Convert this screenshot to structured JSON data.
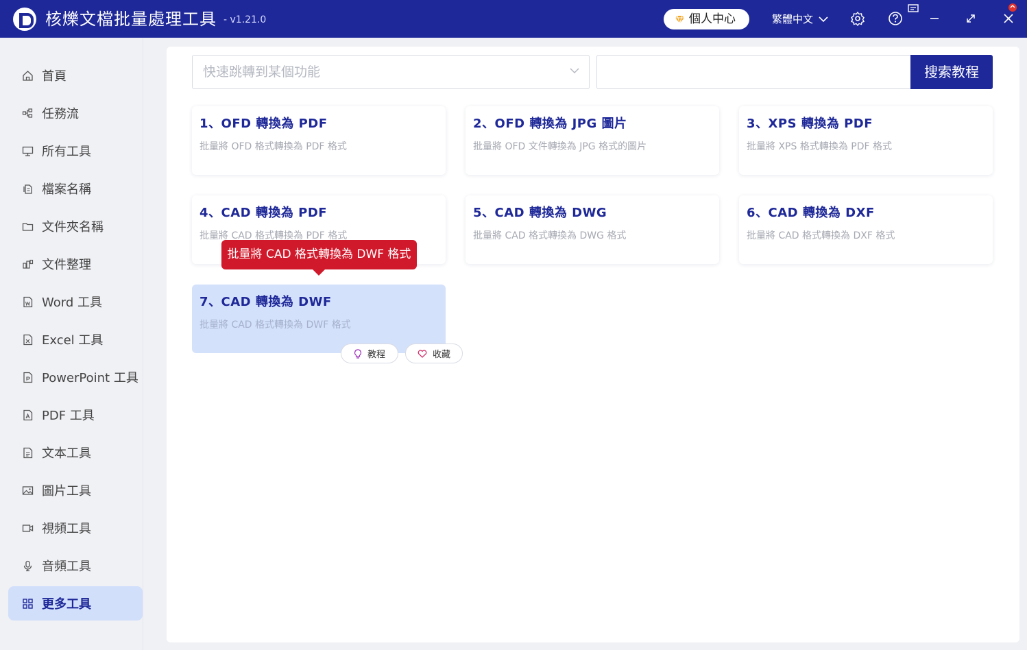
{
  "app": {
    "title": "核爍文檔批量處理工具",
    "version": "- v1.21.0"
  },
  "header": {
    "user_center": "個人中心",
    "language": "繁體中文"
  },
  "sidebar": {
    "items": [
      {
        "label": "首頁",
        "icon": "home-icon"
      },
      {
        "label": "任務流",
        "icon": "workflow-icon"
      },
      {
        "label": "所有工具",
        "icon": "monitor-icon"
      },
      {
        "label": "檔案名稱",
        "icon": "file-copy-icon"
      },
      {
        "label": "文件夾名稱",
        "icon": "folder-icon"
      },
      {
        "label": "文件整理",
        "icon": "organize-icon"
      },
      {
        "label": "Word 工具",
        "icon": "word-file-icon"
      },
      {
        "label": "Excel 工具",
        "icon": "excel-file-icon"
      },
      {
        "label": "PowerPoint 工具",
        "icon": "ppt-file-icon"
      },
      {
        "label": "PDF 工具",
        "icon": "pdf-file-icon"
      },
      {
        "label": "文本工具",
        "icon": "text-file-icon"
      },
      {
        "label": "圖片工具",
        "icon": "image-icon"
      },
      {
        "label": "視頻工具",
        "icon": "video-icon"
      },
      {
        "label": "音頻工具",
        "icon": "microphone-icon"
      },
      {
        "label": "更多工具",
        "icon": "grid-icon",
        "active": true
      }
    ]
  },
  "search": {
    "select_placeholder": "快速跳轉到某個功能",
    "input_value": "",
    "button_label": "搜索教程"
  },
  "cards": [
    {
      "title": "1、OFD 轉換為 PDF",
      "desc": "批量將 OFD 格式轉換為 PDF 格式"
    },
    {
      "title": "2、OFD 轉換為 JPG 圖片",
      "desc": "批量將 OFD 文件轉換為 JPG 格式的圖片"
    },
    {
      "title": "3、XPS 轉換為 PDF",
      "desc": "批量將 XPS 格式轉換為 PDF 格式"
    },
    {
      "title": "4、CAD 轉換為 PDF",
      "desc": "批量將 CAD 格式轉換為 PDF 格式"
    },
    {
      "title": "5、CAD 轉換為 DWG",
      "desc": "批量將 CAD 格式轉換為 DWG 格式"
    },
    {
      "title": "6、CAD 轉換為 DXF",
      "desc": "批量將 CAD 格式轉換為 DXF 格式"
    },
    {
      "title": "7、CAD 轉換為 DWF",
      "desc": "批量將 CAD 格式轉換為 DWF 格式"
    }
  ],
  "tooltip": {
    "text": "批量將 CAD 格式轉換為 DWF 格式"
  },
  "card_actions": {
    "tutorial_label": "教程",
    "favorite_label": "收藏"
  },
  "colors": {
    "brand": "#1e2898",
    "active_bg": "#d2dffb",
    "tooltip_bg": "#d01a2c"
  }
}
